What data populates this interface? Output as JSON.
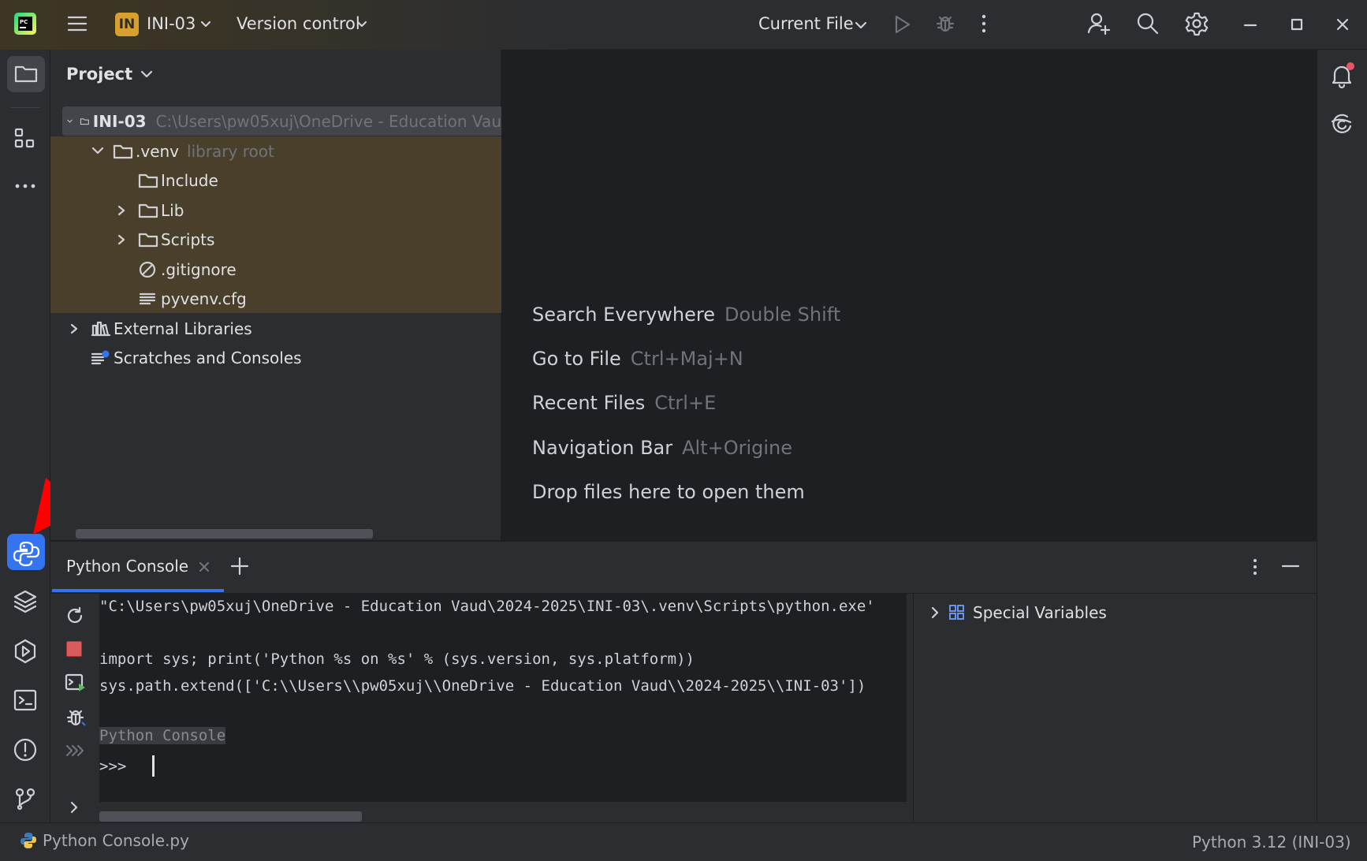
{
  "titlebar": {
    "project_badge": "IN",
    "project_name": "INI-03",
    "vcs_label": "Version control",
    "run_config": "Current File"
  },
  "project_panel": {
    "title": "Project",
    "root": {
      "name": "INI-03",
      "path": "C:\\Users\\pw05xuj\\OneDrive - Education Vau"
    },
    "venv": {
      "name": ".venv",
      "hint": "library root"
    },
    "items": [
      {
        "label": "Include"
      },
      {
        "label": "Lib"
      },
      {
        "label": "Scripts"
      },
      {
        "label": ".gitignore"
      },
      {
        "label": "pyvenv.cfg"
      }
    ],
    "external_libraries": "External Libraries",
    "scratches": "Scratches and Consoles"
  },
  "editor_hints": [
    {
      "label": "Search Everywhere",
      "shortcut": "Double Shift"
    },
    {
      "label": "Go to File",
      "shortcut": "Ctrl+Maj+N"
    },
    {
      "label": "Recent Files",
      "shortcut": "Ctrl+E"
    },
    {
      "label": "Navigation Bar",
      "shortcut": "Alt+Origine"
    },
    {
      "label": "Drop files here to open them",
      "shortcut": ""
    }
  ],
  "console": {
    "tab_label": "Python Console",
    "lines": [
      "\"C:\\Users\\pw05xuj\\OneDrive - Education Vaud\\2024-2025\\INI-03\\.venv\\Scripts\\python.exe'",
      "import sys; print('Python %s on %s' % (sys.version, sys.platform))",
      "sys.path.extend(['C:\\\\Users\\\\pw05xuj\\\\OneDrive - Education Vaud\\\\2024-2025\\\\INI-03'])"
    ],
    "banner": "Python Console",
    "prompt": ">>>",
    "variables_label": "Special Variables"
  },
  "statusbar": {
    "file": "Python Console.py",
    "interpreter": "Python 3.12 (INI-03)"
  },
  "colors": {
    "accent": "#3574f0",
    "arrow": "#ff0000",
    "notification_dot": "#e55765",
    "venv_highlight": "#4a3f2a"
  }
}
